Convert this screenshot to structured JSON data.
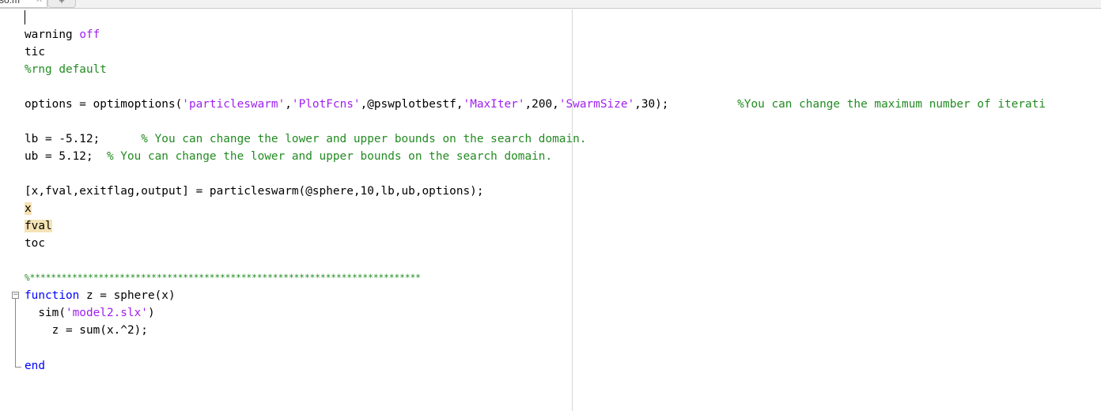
{
  "tab": {
    "filename": "so.m",
    "close_glyph": "✕",
    "add_glyph": "+"
  },
  "code": {
    "line_warning": {
      "cmd": "warning",
      "arg": "off"
    },
    "line_tic": "tic",
    "line_rng": "%rng default",
    "line_options": {
      "a": "options = optimoptions(",
      "s1": "'particleswarm'",
      "c1": ",",
      "s2": "'PlotFcns'",
      "b": ",@pswplotbestf,",
      "s3": "'MaxIter'",
      "c2": ",200,",
      "s4": "'SwarmSize'",
      "c3": ",30);",
      "gap": "          ",
      "comment": "%You can change the maximum number of iterati"
    },
    "line_lb": {
      "code": "lb = -5.12;      ",
      "comment": "% You can change the lower and upper bounds on the search domain."
    },
    "line_ub": {
      "code": "ub = 5.12;  ",
      "comment": "% You can change the lower and upper bounds on the search domain."
    },
    "line_call": "[x,fval,exitflag,output] = particleswarm(@sphere,10,lb,ub,options);",
    "line_x": "x",
    "line_fval": "fval",
    "line_toc": "toc",
    "line_separator": "%**************************************************************************",
    "line_function": {
      "kw": "function",
      "rest": " z = sphere(x)"
    },
    "line_sim": {
      "indent": "  sim(",
      "str": "'model2.slx'",
      "close": ")"
    },
    "line_sum": "    z = sum(x.^2);",
    "line_end": "end"
  }
}
